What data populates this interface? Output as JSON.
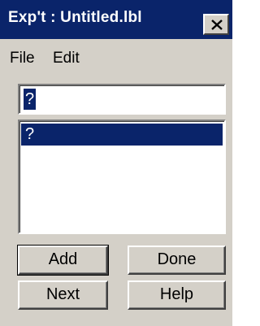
{
  "window": {
    "title": "Exp't : Untitled.lbl",
    "close_icon": "close-x-icon"
  },
  "menu": {
    "file": "File",
    "edit": "Edit"
  },
  "input": {
    "value": "?"
  },
  "list": {
    "items": [
      "?"
    ]
  },
  "buttons": {
    "add": "Add",
    "done": "Done",
    "next": "Next",
    "help": "Help"
  },
  "colors": {
    "titlebar": "#0a246a",
    "face": "#d4d0c8",
    "selection": "#0a246a"
  }
}
